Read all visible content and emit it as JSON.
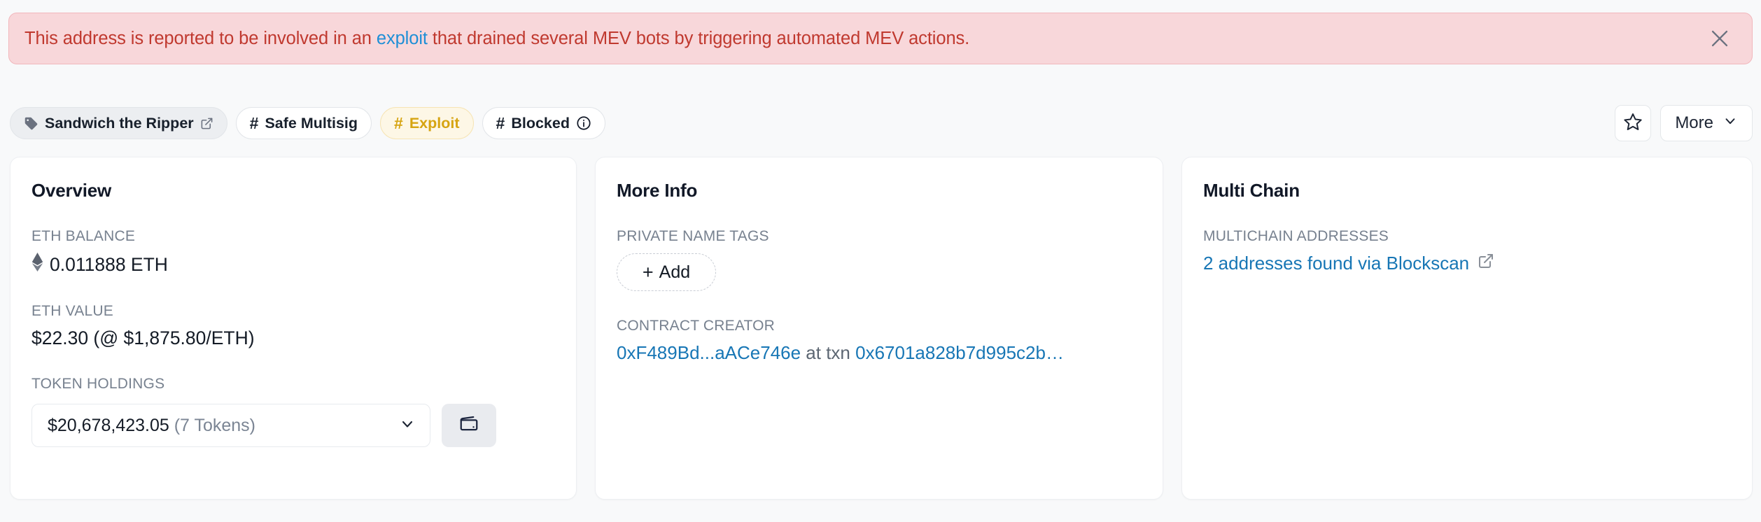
{
  "alert": {
    "text_before": "This address is reported to be involved in an ",
    "link_text": "exploit",
    "text_after": " that drained several MEV bots by triggering automated MEV actions.",
    "close_icon": "close-icon",
    "bg_color": "#f8d7da",
    "text_color": "#c0392f",
    "link_color": "#1f8fd6"
  },
  "tags": [
    {
      "label": "Sandwich the Ripper",
      "icon": "tag-icon",
      "external": true,
      "style": "grey"
    },
    {
      "label": "Safe Multisig",
      "icon": "hash-icon",
      "external": false,
      "style": "white"
    },
    {
      "label": "Exploit",
      "icon": "hash-icon",
      "external": false,
      "style": "warn",
      "color": "#d6a411"
    },
    {
      "label": "Blocked",
      "icon": "hash-icon",
      "external": false,
      "style": "white",
      "info": true
    }
  ],
  "actions": {
    "star_icon": "star-icon",
    "more_label": "More",
    "more_chevron": "chevron-down-icon"
  },
  "overview": {
    "title": "Overview",
    "eth_balance_label": "ETH BALANCE",
    "eth_balance_value": "0.011888 ETH",
    "eth_balance_icon": "ethereum-icon",
    "eth_value_label": "ETH VALUE",
    "eth_value_value": "$22.30 (@ $1,875.80/ETH)",
    "token_holdings_label": "TOKEN HOLDINGS",
    "token_holdings_amount": "$20,678,423.05",
    "token_holdings_count": "(7 Tokens)",
    "token_chevron": "chevron-down-icon",
    "wallet_icon": "wallet-icon"
  },
  "more_info": {
    "title": "More Info",
    "private_name_tags_label": "PRIVATE NAME TAGS",
    "add_button_label": "Add",
    "add_button_icon": "plus-icon",
    "contract_creator_label": "CONTRACT CREATOR",
    "creator_address": "0xF489Bd...aACe746e",
    "creator_at_txn": " at txn ",
    "creator_txn": "0x6701a828b7d995c2b…"
  },
  "multi_chain": {
    "title": "Multi Chain",
    "multichain_addresses_label": "MULTICHAIN ADDRESSES",
    "multichain_link": "2 addresses found via Blockscan",
    "external_icon": "external-link-icon"
  }
}
